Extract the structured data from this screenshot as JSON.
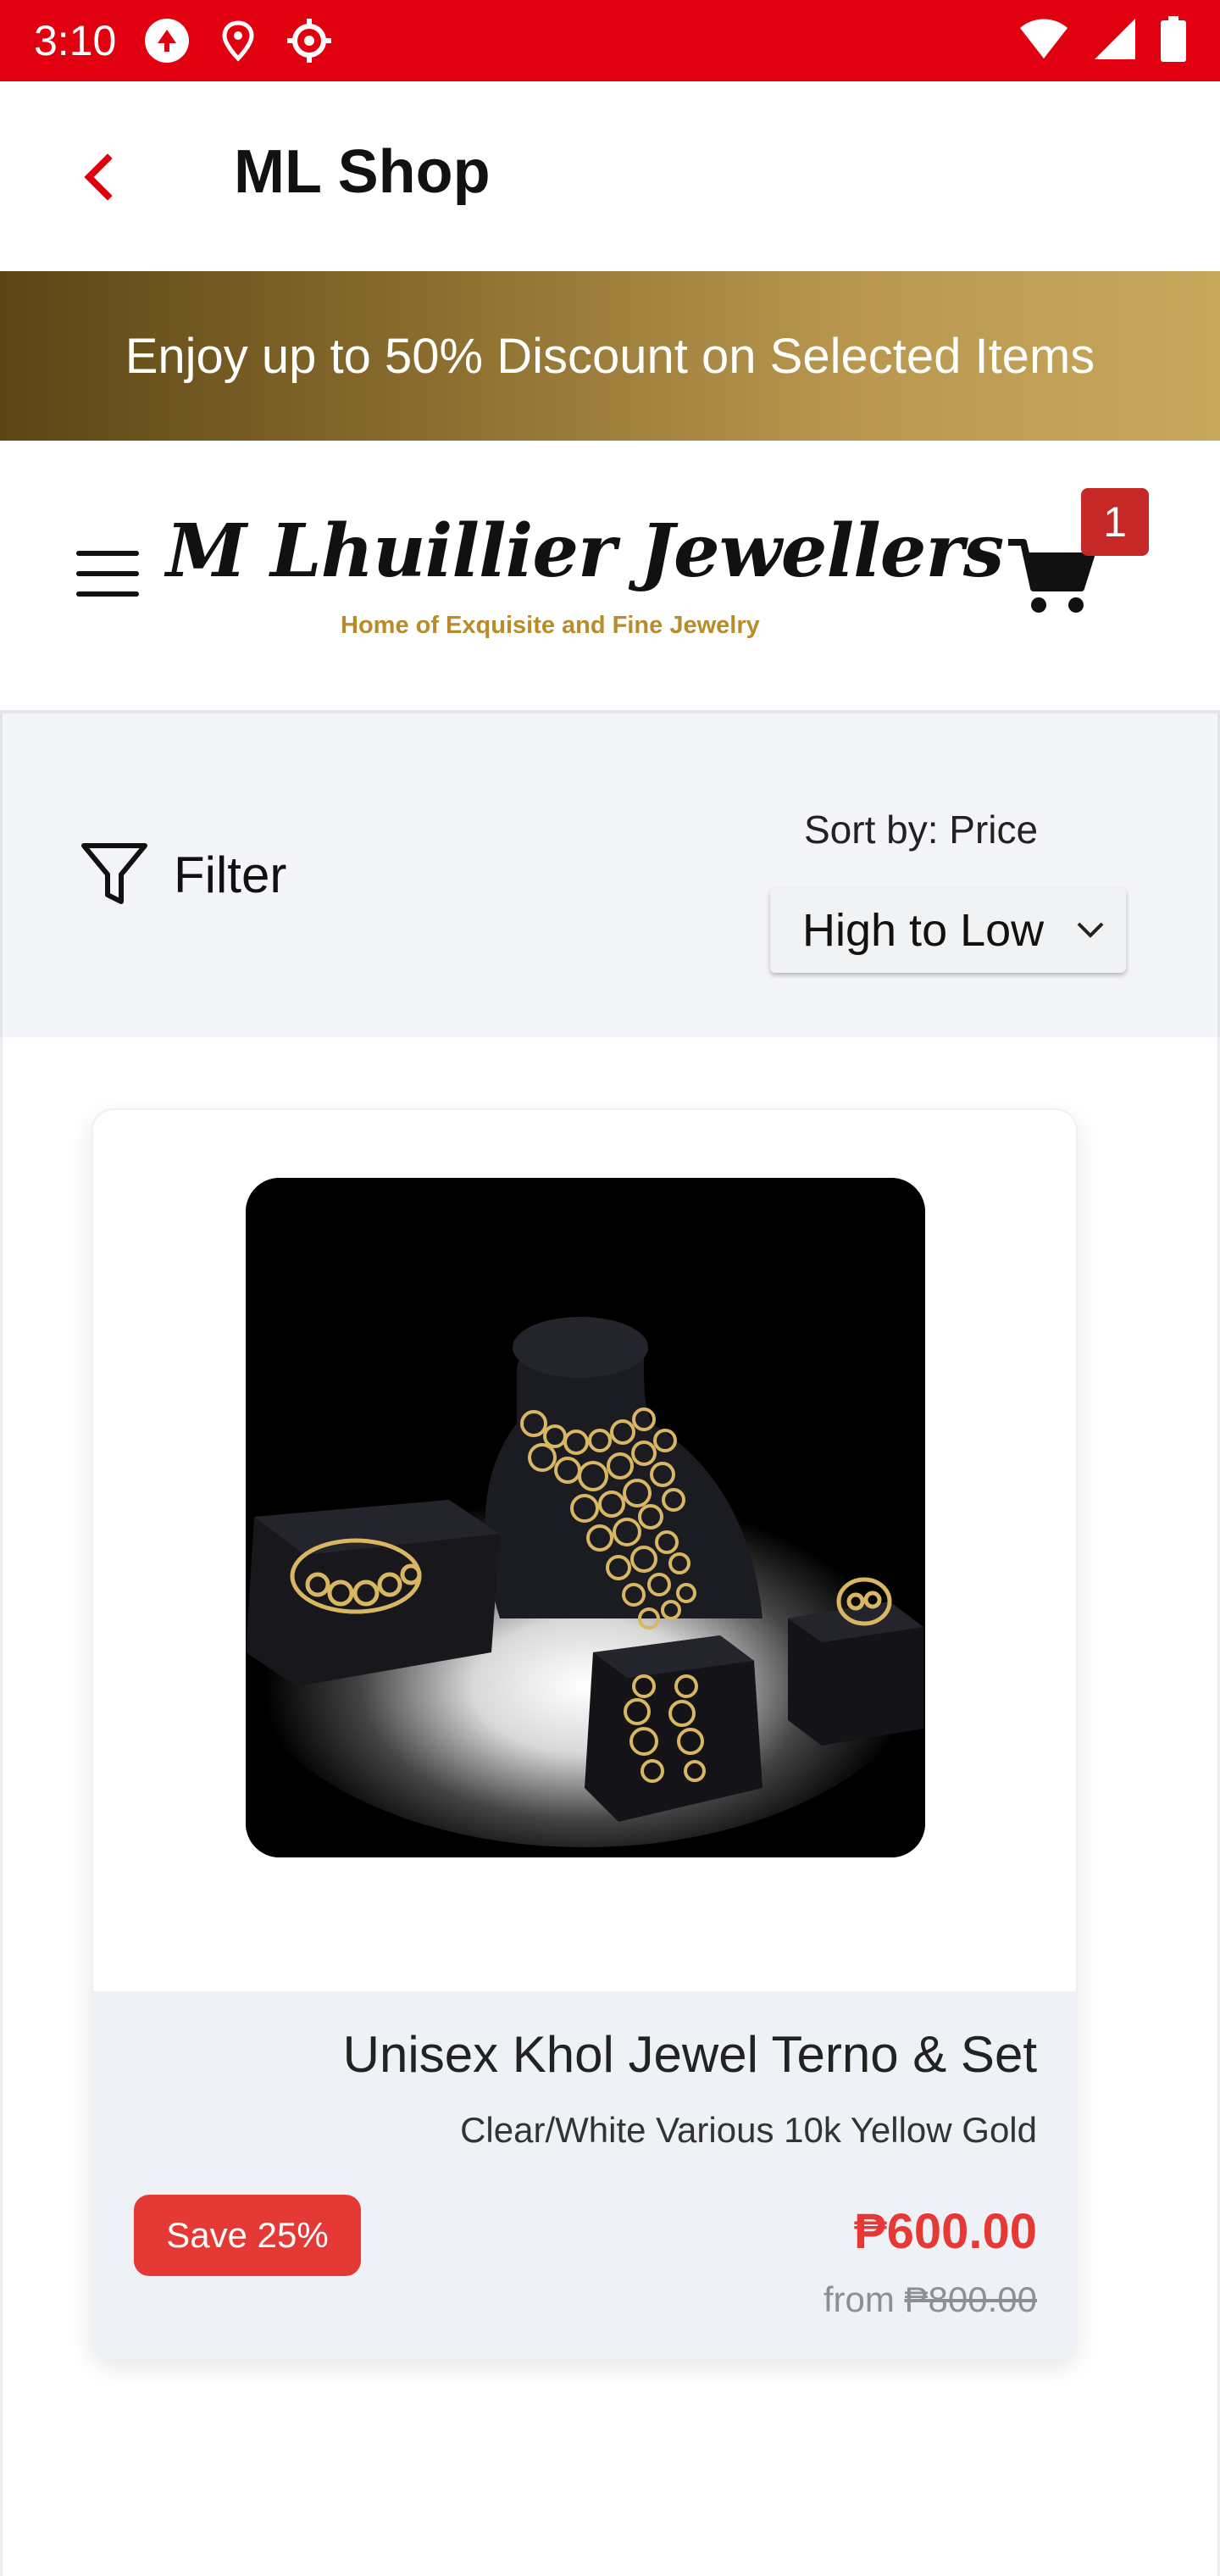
{
  "status_bar": {
    "time": "3:10",
    "icons": [
      "data-saver-icon",
      "location-icon",
      "settings-icon",
      "wifi-icon",
      "signal-icon",
      "battery-icon"
    ]
  },
  "app_bar": {
    "title": "ML Shop",
    "back_icon": "chevron-left-icon"
  },
  "promo": {
    "text": "Enjoy up to 50% Discount on Selected Items"
  },
  "header": {
    "logo_name": "M Lhuillier Jewellers",
    "logo_tagline": "Home of Exquisite and Fine Jewelry",
    "cart_count": "1"
  },
  "filter_bar": {
    "filter_label": "Filter",
    "sort_label": "Sort by: Price",
    "sort_value": "High to Low"
  },
  "products": [
    {
      "name": "Unisex Khol Jewel Terno & Set",
      "subtitle": "Clear/White Various 10k Yellow Gold",
      "save_badge": "Save 25%",
      "price": "₱600.00",
      "from_prefix": "from",
      "original_price": "₱800.00"
    }
  ],
  "colors": {
    "status_bar": "#e0000f",
    "accent_red": "#e53935",
    "promo_gold": "#b9974f",
    "tagline_gold": "#b98b2a"
  }
}
